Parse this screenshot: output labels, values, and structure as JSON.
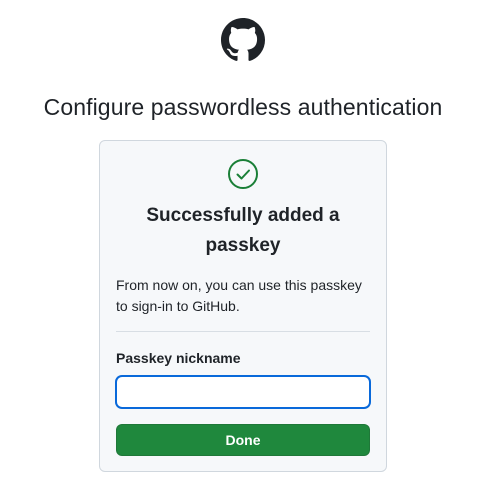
{
  "logo": {
    "icon": "github-octocat-icon"
  },
  "page_title": "Configure passwordless authentication",
  "card": {
    "status_icon": "check-circle-icon",
    "success_title_line1": "Successfully added a",
    "success_title_line2": "passkey",
    "description_line1": "From now on, you can use this passkey",
    "description_line2": "to sign-in to GitHub.",
    "nickname_label": "Passkey nickname",
    "nickname_value": "",
    "nickname_placeholder": "",
    "done_label": "Done"
  },
  "colors": {
    "success_green": "#1a7f37",
    "button_green": "#1f883d",
    "focus_blue": "#0969da",
    "card_background": "#f6f8fa",
    "border": "#d0d7de"
  }
}
